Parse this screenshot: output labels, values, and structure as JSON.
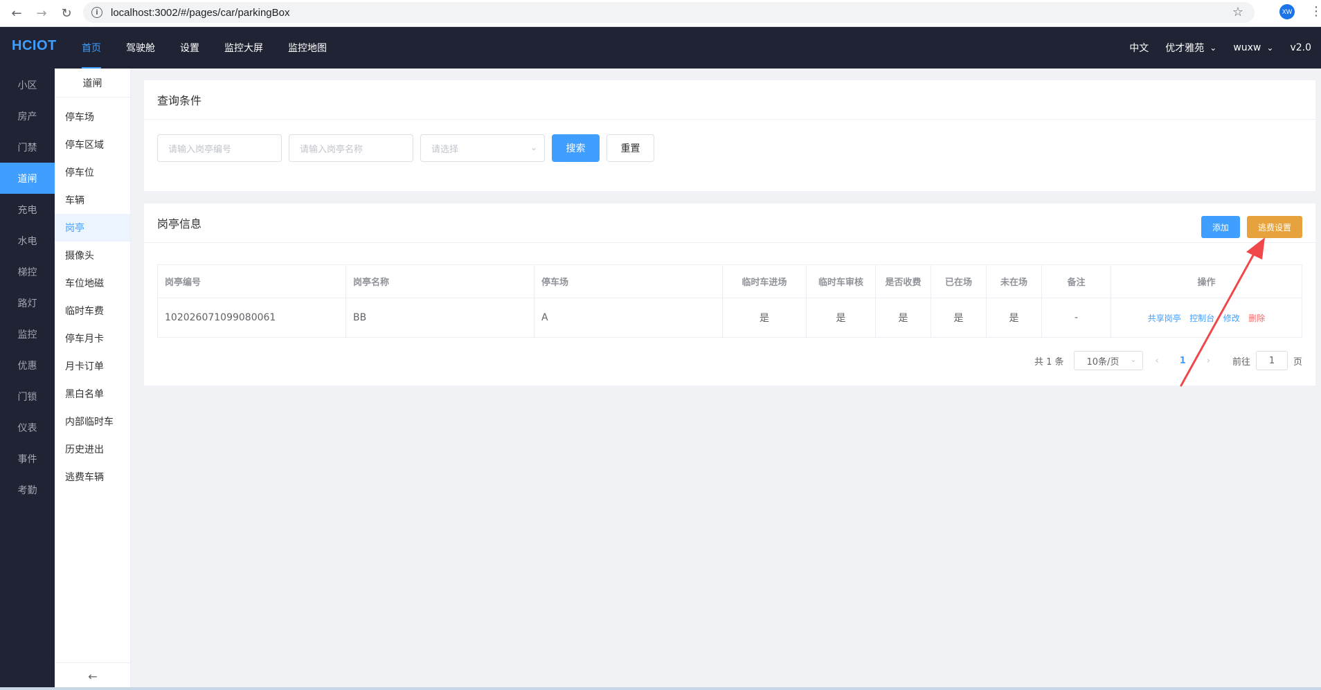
{
  "browser": {
    "url": "localhost:3002/#/pages/car/parkingBox",
    "profile_initials": "XW"
  },
  "header": {
    "logo": "HCIOT",
    "nav": [
      "首页",
      "驾驶舱",
      "设置",
      "监控大屏",
      "监控地图"
    ],
    "active_nav": "首页",
    "language": "中文",
    "community": "优才雅苑",
    "user": "wuxw",
    "version": "v2.0"
  },
  "sidebar": {
    "items": [
      "小区",
      "房产",
      "门禁",
      "道闸",
      "充电",
      "水电",
      "梯控",
      "路灯",
      "监控",
      "优惠",
      "门锁",
      "仪表",
      "事件",
      "考勤"
    ],
    "active": "道闸"
  },
  "subsidebar": {
    "title": "道闸",
    "items": [
      "停车场",
      "停车区域",
      "停车位",
      "车辆",
      "岗亭",
      "摄像头",
      "车位地磁",
      "临时车费",
      "停车月卡",
      "月卡订单",
      "黑白名单",
      "内部临时车",
      "历史进出",
      "逃费车辆"
    ],
    "active": "岗亭"
  },
  "query": {
    "title": "查询条件",
    "box_id_placeholder": "请输入岗亭编号",
    "box_name_placeholder": "请输入岗亭名称",
    "select_placeholder": "请选择",
    "search_label": "搜索",
    "reset_label": "重置"
  },
  "list": {
    "title": "岗亭信息",
    "add_label": "添加",
    "fee_setting_label": "逃费设置",
    "columns": [
      "岗亭编号",
      "岗亭名称",
      "停车场",
      "临时车进场",
      "临时车审核",
      "是否收费",
      "已在场",
      "未在场",
      "备注",
      "操作"
    ],
    "rows": [
      {
        "box_id": "102026071099080061",
        "box_name": "BB",
        "parking_lot": "A",
        "temp_entry": "是",
        "temp_audit": "是",
        "charge": "是",
        "in_yard": "是",
        "not_in_yard": "是",
        "remark": "-",
        "ops": [
          "共享岗亭",
          "控制台",
          "修改",
          "删除"
        ]
      }
    ]
  },
  "pagination": {
    "total": "共 1 条",
    "page_size": "10条/页",
    "current_page": "1",
    "goto_label": "前往",
    "goto_value": "1",
    "page_suffix": "页"
  },
  "colors": {
    "primary": "#409eff",
    "warning": "#e6a23c",
    "danger": "#f56c6c",
    "header_bg": "#1f2333",
    "annotation_arrow": "#f04848"
  }
}
